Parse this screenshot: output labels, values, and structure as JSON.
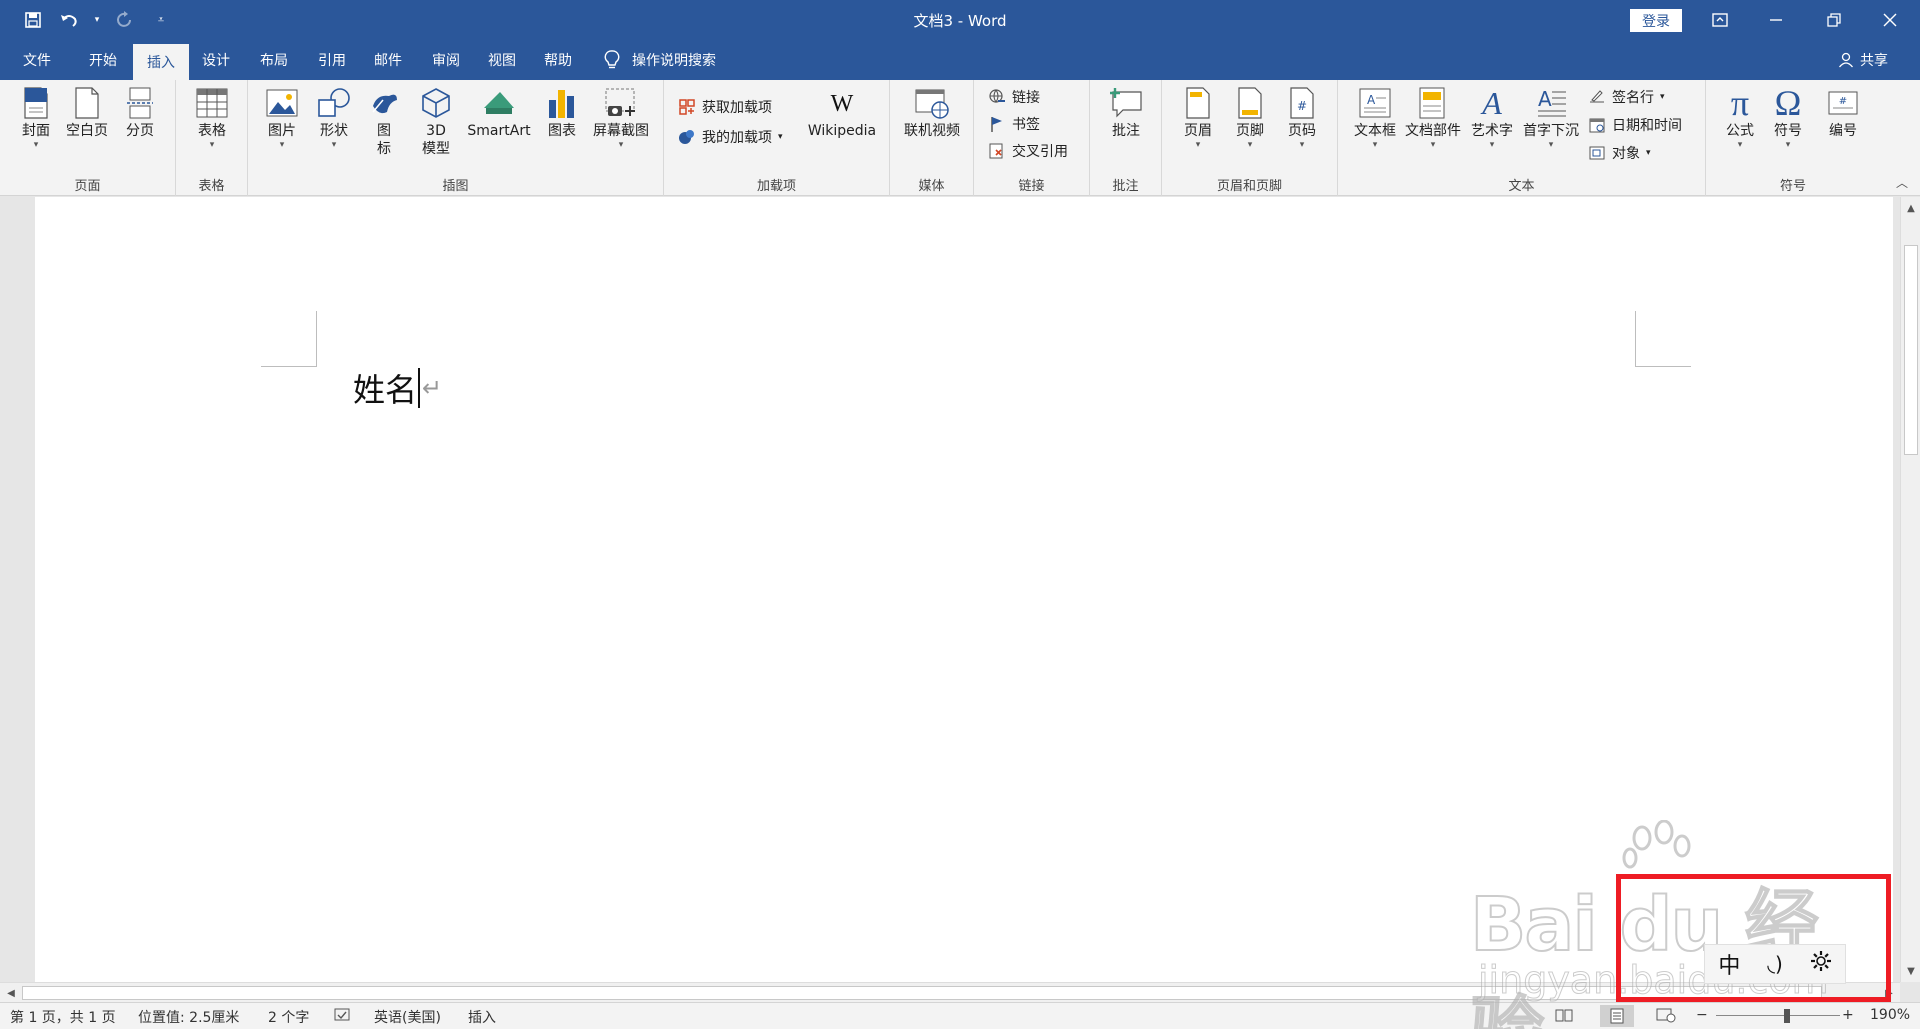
{
  "window": {
    "title": "文档3 - Word",
    "login_label": "登录"
  },
  "qat": {
    "save_icon": "save-icon",
    "undo_icon": "undo-icon",
    "redo_icon": "redo-icon",
    "customize_icon": "customize-icon"
  },
  "tabs": [
    {
      "label": "文件"
    },
    {
      "label": "开始"
    },
    {
      "label": "插入",
      "active": true
    },
    {
      "label": "设计"
    },
    {
      "label": "布局"
    },
    {
      "label": "引用"
    },
    {
      "label": "邮件"
    },
    {
      "label": "审阅"
    },
    {
      "label": "视图"
    },
    {
      "label": "帮助"
    }
  ],
  "tell_me": "操作说明搜索",
  "share_label": "共享",
  "ribbon": {
    "pages": {
      "label": "页面",
      "cover": "封面",
      "blank": "空白页",
      "break": "分页"
    },
    "tables": {
      "label": "表格",
      "table": "表格"
    },
    "illustrations": {
      "label": "插图",
      "picture": "图片",
      "shapes": "形状",
      "icons_line1": "图",
      "icons_line2": "标",
      "model_line1": "3D",
      "model_line2": "模型",
      "smartart": "SmartArt",
      "chart": "图表",
      "screenshot": "屏幕截图"
    },
    "addins": {
      "label": "加载项",
      "get": "获取加载项",
      "mine": "我的加载项",
      "wikipedia": "Wikipedia"
    },
    "media": {
      "label": "媒体",
      "video": "联机视频"
    },
    "links": {
      "label": "链接",
      "link": "链接",
      "bookmark": "书签",
      "crossref": "交叉引用"
    },
    "comments": {
      "label": "批注",
      "comment": "批注"
    },
    "header_footer": {
      "label": "页眉和页脚",
      "header": "页眉",
      "footer": "页脚",
      "page_number": "页码"
    },
    "text": {
      "label": "文本",
      "textbox": "文本框",
      "quickparts": "文档部件",
      "wordart": "艺术字",
      "dropcap": "首字下沉",
      "signature": "签名行",
      "datetime": "日期和时间",
      "object": "对象"
    },
    "symbols": {
      "label": "符号",
      "equation": "公式",
      "symbol": "符号",
      "number": "编号"
    }
  },
  "document": {
    "text": "姓名"
  },
  "status": {
    "page": "第 1 页，共 1 页",
    "position": "位置值: 2.5厘米",
    "words": "2 个字",
    "language": "英语(美国)",
    "mode": "插入",
    "zoom": "190%"
  },
  "ime": {
    "mode": "中",
    "punct": "◟)",
    "settings_icon": "gear-icon"
  },
  "watermark": {
    "main": "Bai du 经验",
    "sub": "jingyan.baidu.com"
  },
  "colors": {
    "brand": "#2b579a",
    "highlight": "#ee1c24"
  }
}
